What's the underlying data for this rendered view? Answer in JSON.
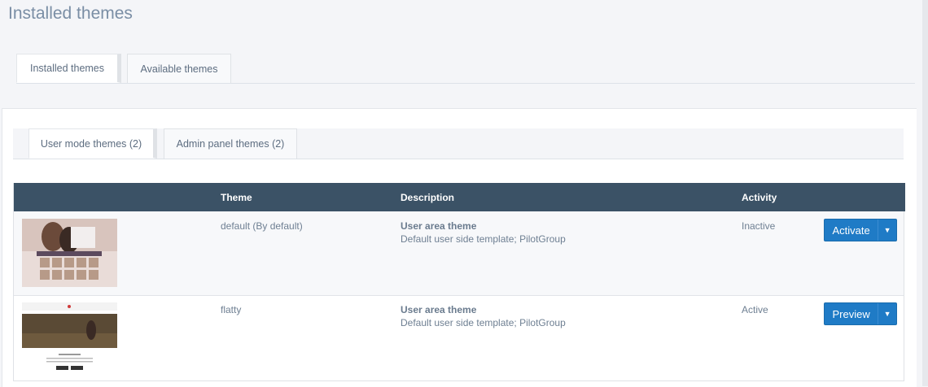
{
  "page": {
    "title": "Installed themes"
  },
  "top_tabs": [
    {
      "label": "Installed themes",
      "active": true
    },
    {
      "label": "Available themes",
      "active": false
    }
  ],
  "sub_tabs": [
    {
      "label": "User mode themes (2)",
      "active": true
    },
    {
      "label": "Admin panel themes (2)",
      "active": false
    }
  ],
  "table": {
    "headers": {
      "theme": "Theme",
      "description": "Description",
      "activity": "Activity"
    },
    "rows": [
      {
        "theme": "default  (By default)",
        "desc_title": "User area theme",
        "desc_text": "Default user side template; PilotGroup",
        "activity": "Inactive",
        "button": "Activate"
      },
      {
        "theme": "flatty",
        "desc_title": "User area theme",
        "desc_text": "Default user side template; PilotGroup",
        "activity": "Active",
        "button": "Preview"
      }
    ]
  },
  "colors": {
    "header_bg": "#3b5266",
    "button": "#1f7bc6",
    "title": "#7a8ea5"
  }
}
